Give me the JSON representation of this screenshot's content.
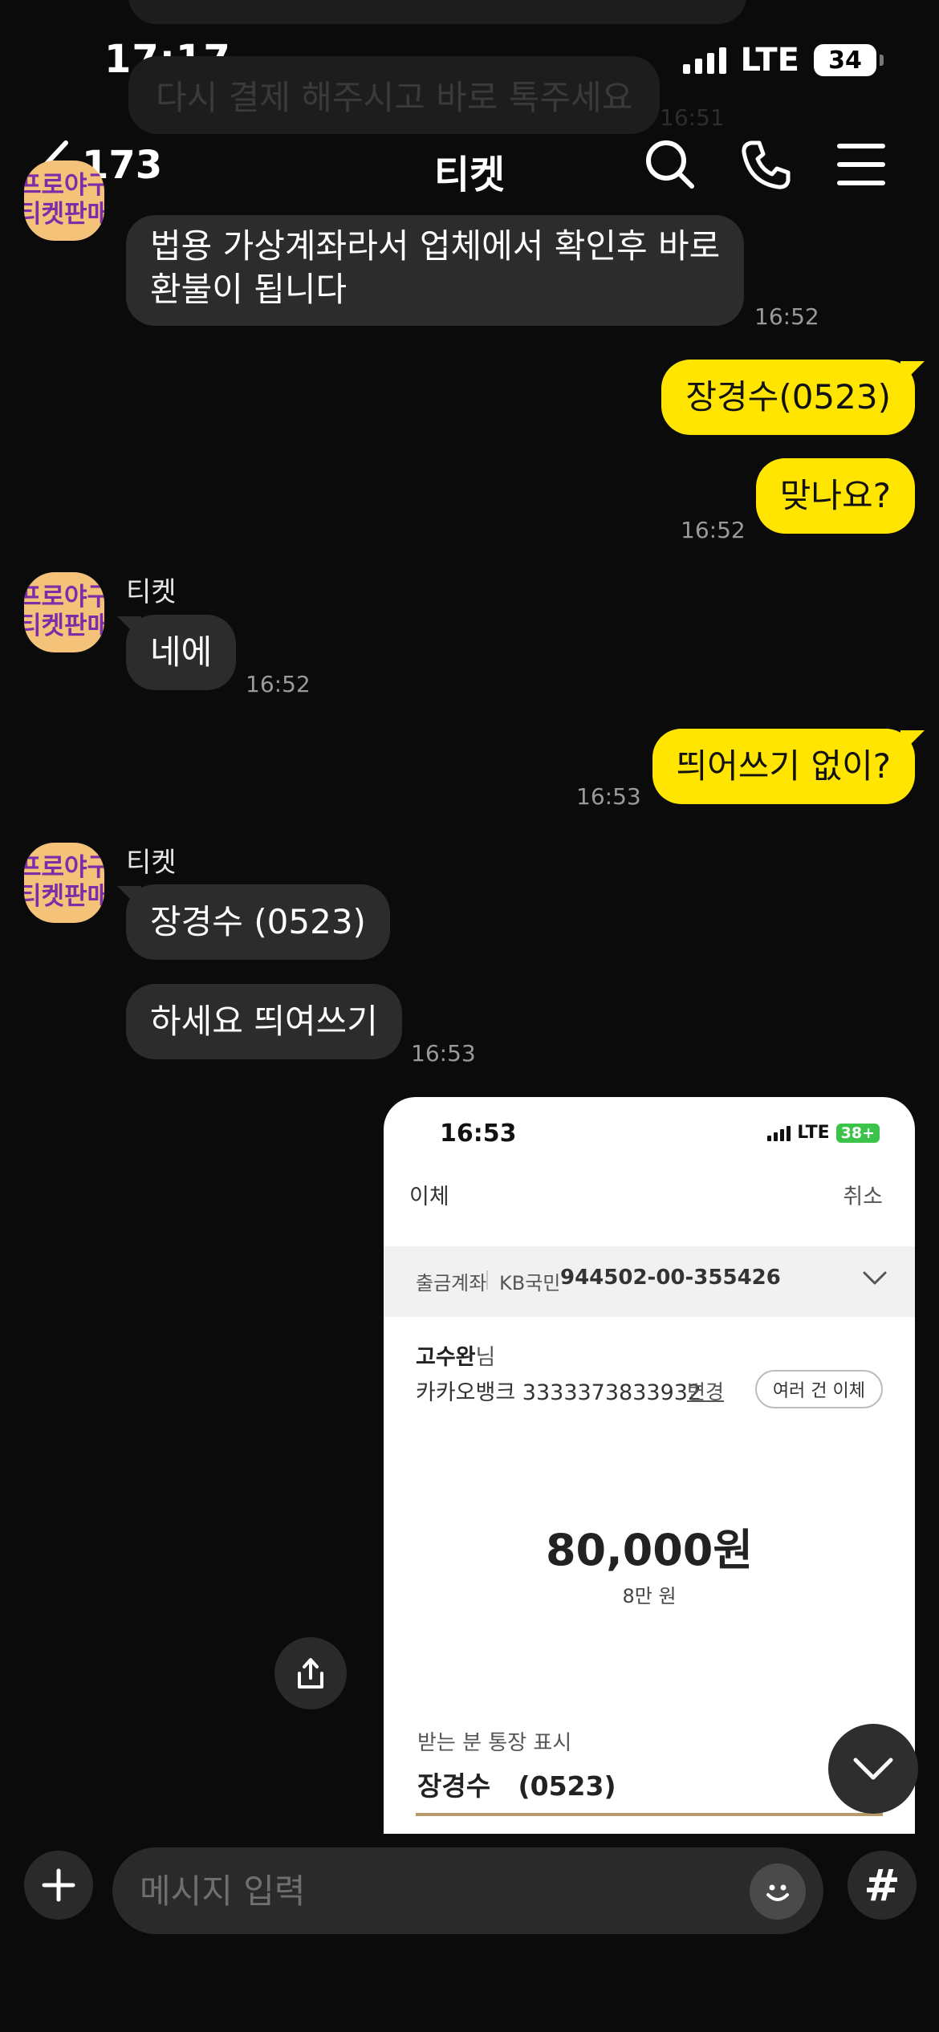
{
  "status_bar": {
    "time": "17:17",
    "network": "LTE",
    "battery": "34"
  },
  "faded": {
    "partial_message": "다시 결제 해주시고 바로 톡주세요",
    "partial_time": "16:51"
  },
  "header": {
    "unread_count": "173",
    "title": "티켓"
  },
  "messages": [
    {
      "from": "티켓",
      "text_line1": "법용 가상계좌라서 업체에서 확인후 바로",
      "text_line2": "환불이 됩니다",
      "time": "16:52"
    },
    {
      "from": "me",
      "text": "장경수(0523)"
    },
    {
      "from": "me",
      "text": "맞나요?",
      "time": "16:52"
    },
    {
      "from": "티켓",
      "sender": "티켓",
      "text": "네에",
      "time": "16:52"
    },
    {
      "from": "me",
      "text": "띄어쓰기 없이?",
      "time": "16:53"
    },
    {
      "from": "티켓",
      "sender": "티켓",
      "text": "장경수 (0523)"
    },
    {
      "from": "티켓",
      "text": "하세요 띄여쓰기",
      "time": "16:53"
    }
  ],
  "avatar": {
    "line1": "프로야구",
    "line2": "티켓판매"
  },
  "screenshot": {
    "time": "16:53",
    "network": "LTE",
    "battery": "38+",
    "title": "이체",
    "cancel": "취소",
    "account_label": "출금계좌",
    "account_bank": "KB국민",
    "account_number": "944502-00-355426",
    "recipient_name": "고수완",
    "recipient_suffix": "님",
    "recipient_bank": "카카오뱅크 3333373833932",
    "change_label": "변경",
    "multi_transfer": "여러 건 이체",
    "amount": "80,000원",
    "amount_korean": "8만 원",
    "recipient_display_label": "받는 분 통장 표시",
    "recipient_display_value": "장경수   (0523)"
  },
  "input": {
    "placeholder": "메시지 입력",
    "hash": "#"
  },
  "colors": {
    "background": "#0b0b0b",
    "sent_bubble": "#ffe500",
    "received_bubble": "#2c2c2c"
  }
}
